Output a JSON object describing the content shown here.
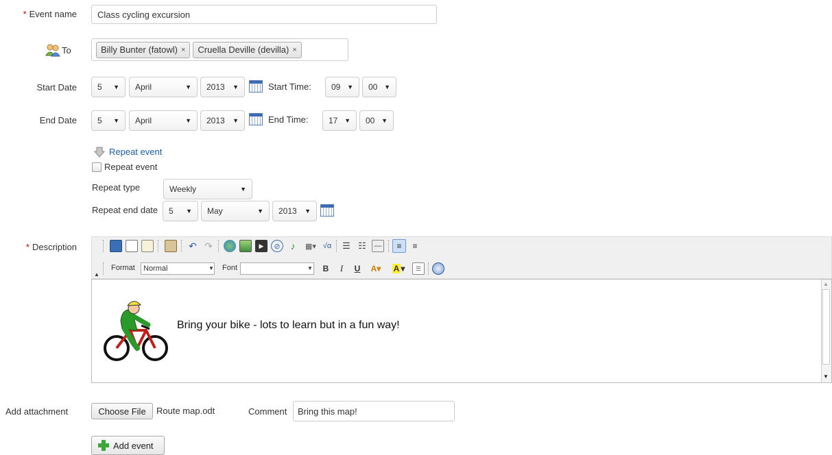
{
  "event_name": {
    "label": "Event name",
    "value": "Class cycling excursion"
  },
  "to": {
    "label": "To",
    "recipients": [
      "Billy Bunter (fatowl)",
      "Cruella Deville (devilla)"
    ],
    "remove": "×"
  },
  "start": {
    "label": "Start Date",
    "day": "5",
    "month": "April",
    "year": "2013",
    "time_label": "Start Time:",
    "hour": "09",
    "minute": "00"
  },
  "end": {
    "label": "End Date",
    "day": "5",
    "month": "April",
    "year": "2013",
    "time_label": "End Time:",
    "hour": "17",
    "minute": "00"
  },
  "repeat": {
    "toggle_link": "Repeat event",
    "checkbox_label": "Repeat event",
    "type_label": "Repeat type",
    "type_value": "Weekly",
    "end_label": "Repeat end date",
    "end_day": "5",
    "end_month": "May",
    "end_year": "2013"
  },
  "description": {
    "label": "Description",
    "format_label": "Format",
    "format_value": "Normal",
    "font_label": "Font",
    "font_value": "",
    "content": "Bring your bike - lots to learn but in a fun way!"
  },
  "attachment": {
    "label": "Add attachment",
    "choose_button": "Choose File",
    "file_name": "Route map.odt",
    "comment_label": "Comment",
    "comment_value": "Bring this map!"
  },
  "add_event_button": "Add event",
  "colors": {
    "required": "#cc0000",
    "link": "#1a5fa8",
    "add_icon": "#3aa83a"
  }
}
